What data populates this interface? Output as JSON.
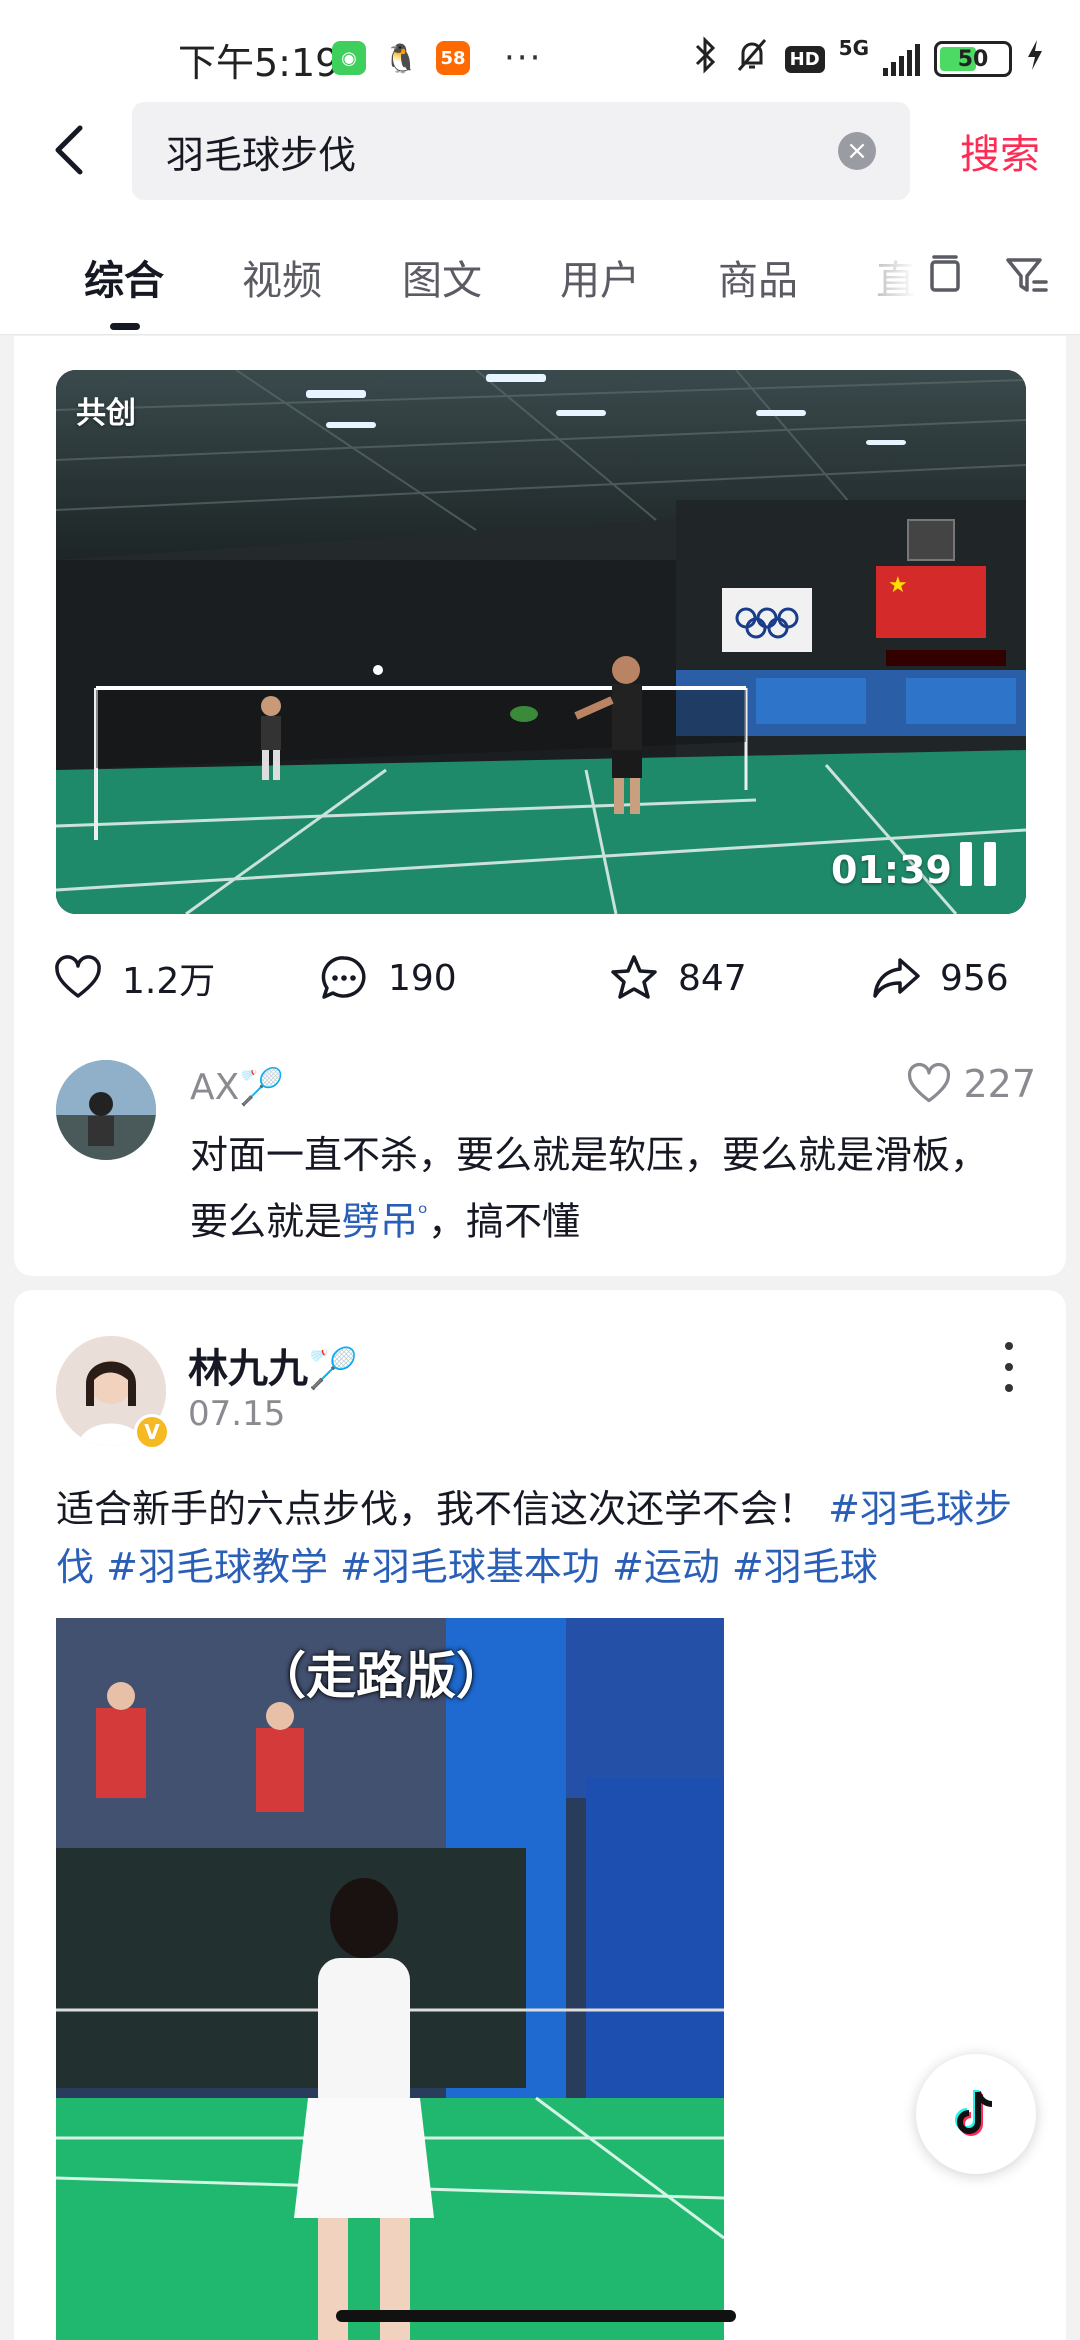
{
  "status_bar": {
    "time": "下午5:19",
    "apps": [
      "wechat-icon",
      "qq-icon",
      "58-app-icon"
    ],
    "app_58_label": "58",
    "more": "···",
    "network": "5G",
    "hd": "HD",
    "battery": "50"
  },
  "search": {
    "query": "羽毛球步伐",
    "submit_label": "搜索"
  },
  "tabs": [
    {
      "label": "综合",
      "active": true
    },
    {
      "label": "视频"
    },
    {
      "label": "图文"
    },
    {
      "label": "用户"
    },
    {
      "label": "商品"
    },
    {
      "label": "直"
    }
  ],
  "video_card": {
    "badge": "共创",
    "duration": "01:39",
    "likes": "1.2万",
    "comments": "190",
    "favorites": "847",
    "shares": "956",
    "top_comment": {
      "user": "AX🏸",
      "likes": "227",
      "text_before": "对面一直不杀，要么就是软压，要么就是滑板，要么就是",
      "link": "劈吊",
      "text_after": "，搞不懂"
    }
  },
  "post_card": {
    "author": "林九九🏸",
    "date": "07.15",
    "verified_badge": "V",
    "text": "适合新手的六点步伐，我不信这次还学不会！",
    "tags": [
      "#羽毛球步伐",
      "#羽毛球教学",
      "#羽毛球基本功",
      "#运动",
      "#羽毛球"
    ],
    "video_title": "（走路版）"
  },
  "colors": {
    "accent": "#fe2c55",
    "link": "#2a5fb8",
    "court": "#1f8a6a"
  }
}
